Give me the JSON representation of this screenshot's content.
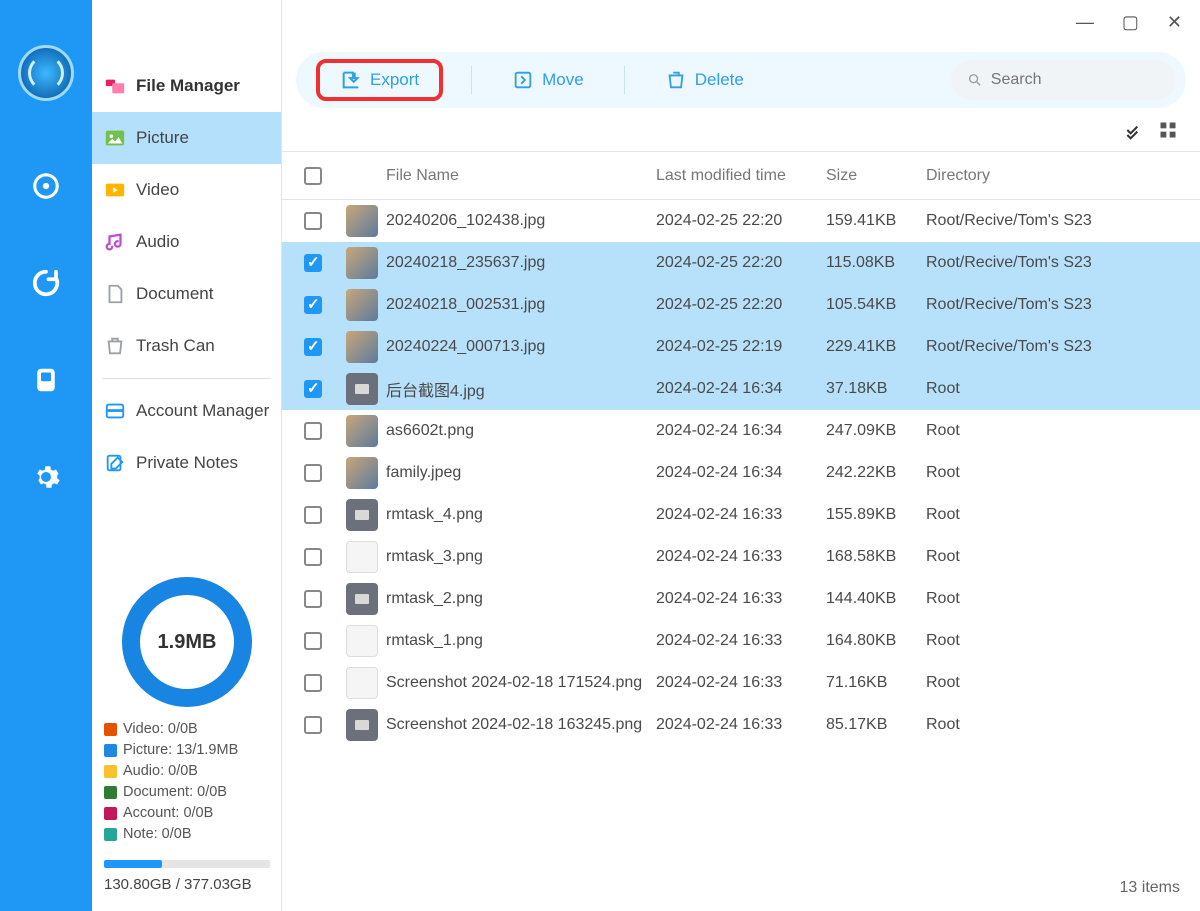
{
  "window": {
    "minimize": "—",
    "maximize": "▢",
    "close": "✕"
  },
  "sidebar": {
    "title": "File Manager",
    "items": [
      {
        "label": "Picture",
        "color": "#6fc24c"
      },
      {
        "label": "Video",
        "color": "#ffb400"
      },
      {
        "label": "Audio",
        "color": "#c04bd4"
      },
      {
        "label": "Document",
        "color": "#9aa0a6"
      },
      {
        "label": "Trash Can",
        "color": "#9aa0a6"
      }
    ],
    "account": "Account Manager",
    "notes": "Private Notes"
  },
  "storage": {
    "donut": "1.9MB",
    "legend": [
      {
        "label": "Video: 0/0B",
        "color": "#e65100"
      },
      {
        "label": "Picture: 13/1.9MB",
        "color": "#1e88e5"
      },
      {
        "label": "Audio: 0/0B",
        "color": "#fbc02d"
      },
      {
        "label": "Document: 0/0B",
        "color": "#2e7d32"
      },
      {
        "label": "Account: 0/0B",
        "color": "#c2185b"
      },
      {
        "label": "Note: 0/0B",
        "color": "#26a69a"
      }
    ],
    "bar_pct": 35,
    "summary": "130.80GB / 377.03GB"
  },
  "toolbar": {
    "export": "Export",
    "move": "Move",
    "delete": "Delete",
    "search_placeholder": "Search"
  },
  "columns": {
    "name": "File Name",
    "time": "Last modified time",
    "size": "Size",
    "dir": "Directory"
  },
  "rows": [
    {
      "sel": false,
      "name": "20240206_102438.jpg",
      "time": "2024-02-25 22:20",
      "size": "159.41KB",
      "dir": "Root/Recive/Tom's S23",
      "thumb": "photo"
    },
    {
      "sel": true,
      "name": "20240218_235637.jpg",
      "time": "2024-02-25 22:20",
      "size": "115.08KB",
      "dir": "Root/Recive/Tom's S23",
      "thumb": "photo"
    },
    {
      "sel": true,
      "name": "20240218_002531.jpg",
      "time": "2024-02-25 22:20",
      "size": "105.54KB",
      "dir": "Root/Recive/Tom's S23",
      "thumb": "photo"
    },
    {
      "sel": true,
      "name": "20240224_000713.jpg",
      "time": "2024-02-25 22:19",
      "size": "229.41KB",
      "dir": "Root/Recive/Tom's S23",
      "thumb": "photo"
    },
    {
      "sel": true,
      "name": "后台截图4.jpg",
      "time": "2024-02-24 16:34",
      "size": "37.18KB",
      "dir": "Root",
      "thumb": "grey"
    },
    {
      "sel": false,
      "name": "as6602t.png",
      "time": "2024-02-24 16:34",
      "size": "247.09KB",
      "dir": "Root",
      "thumb": "photo"
    },
    {
      "sel": false,
      "name": "family.jpeg",
      "time": "2024-02-24 16:34",
      "size": "242.22KB",
      "dir": "Root",
      "thumb": "photo"
    },
    {
      "sel": false,
      "name": "rmtask_4.png",
      "time": "2024-02-24 16:33",
      "size": "155.89KB",
      "dir": "Root",
      "thumb": "grey"
    },
    {
      "sel": false,
      "name": "rmtask_3.png",
      "time": "2024-02-24 16:33",
      "size": "168.58KB",
      "dir": "Root",
      "thumb": "blank"
    },
    {
      "sel": false,
      "name": "rmtask_2.png",
      "time": "2024-02-24 16:33",
      "size": "144.40KB",
      "dir": "Root",
      "thumb": "grey"
    },
    {
      "sel": false,
      "name": "rmtask_1.png",
      "time": "2024-02-24 16:33",
      "size": "164.80KB",
      "dir": "Root",
      "thumb": "blank"
    },
    {
      "sel": false,
      "name": "Screenshot 2024-02-18 171524.png",
      "time": "2024-02-24 16:33",
      "size": "71.16KB",
      "dir": "Root",
      "thumb": "blank"
    },
    {
      "sel": false,
      "name": "Screenshot 2024-02-18 163245.png",
      "time": "2024-02-24 16:33",
      "size": "85.17KB",
      "dir": "Root",
      "thumb": "grey"
    }
  ],
  "footer": "13 items"
}
